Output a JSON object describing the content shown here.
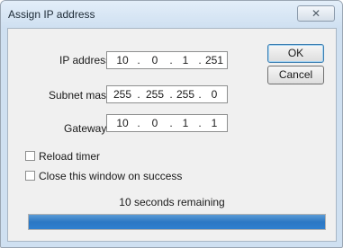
{
  "window": {
    "title": "Assign IP address",
    "close_icon": "close-icon",
    "close_glyph": "✕"
  },
  "form": {
    "ip_label": "IP address",
    "ip": [
      "10",
      "0",
      "1",
      "251"
    ],
    "subnet_label": "Subnet mask",
    "subnet": [
      "255",
      "255",
      "255",
      "0"
    ],
    "gateway_label": "Gateway",
    "gateway": [
      "10",
      "0",
      "1",
      "1"
    ],
    "separator": "."
  },
  "buttons": {
    "ok": "OK",
    "cancel": "Cancel"
  },
  "options": {
    "reload_timer": {
      "label": "Reload timer",
      "checked": false
    },
    "close_on_success": {
      "label": "Close this window on success",
      "checked": false
    }
  },
  "status": {
    "text": "10 seconds remaining",
    "progress": 1.0
  },
  "colors": {
    "progress_fill": "#2f7fcf",
    "titlebar": "#cfe0f1"
  }
}
